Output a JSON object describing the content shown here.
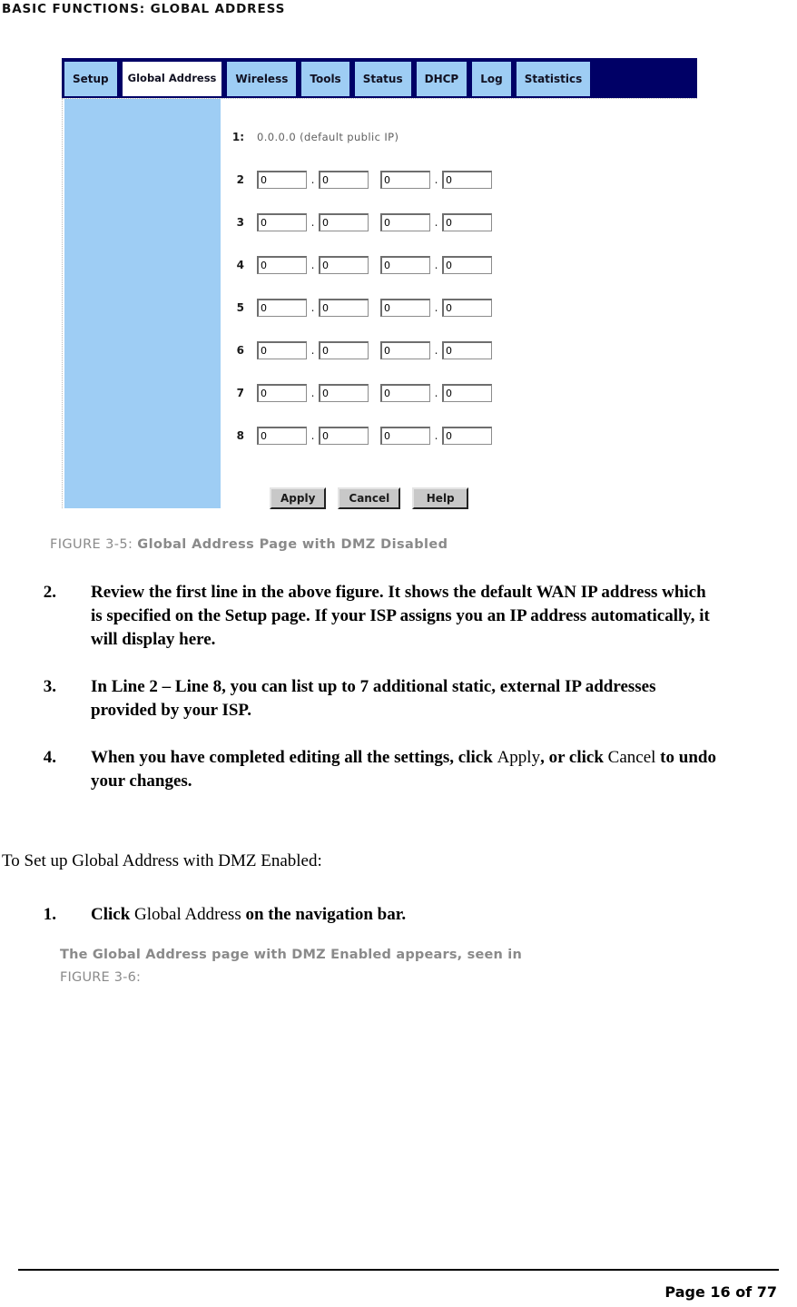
{
  "header": {
    "running_title": "BASIC FUNCTIONS: GLOBAL ADDRESS"
  },
  "figure": {
    "caption_label": "FIGURE 3-5:",
    "caption_title": "Global Address Page with DMZ Disabled",
    "nav_tabs": [
      {
        "label": "Setup",
        "active": false
      },
      {
        "label": "Global Address",
        "active": true
      },
      {
        "label": "Wireless",
        "active": false
      },
      {
        "label": "Tools",
        "active": false
      },
      {
        "label": "Status",
        "active": false
      },
      {
        "label": "DHCP",
        "active": false
      },
      {
        "label": "Log",
        "active": false
      },
      {
        "label": "Statistics",
        "active": false
      }
    ],
    "rows": [
      {
        "num": "1:",
        "type": "static",
        "text": "0.0.0.0 (default public IP)"
      },
      {
        "num": "2",
        "type": "inputs",
        "octets": [
          "0",
          "0",
          "0",
          "0"
        ]
      },
      {
        "num": "3",
        "type": "inputs",
        "octets": [
          "0",
          "0",
          "0",
          "0"
        ]
      },
      {
        "num": "4",
        "type": "inputs",
        "octets": [
          "0",
          "0",
          "0",
          "0"
        ]
      },
      {
        "num": "5",
        "type": "inputs",
        "octets": [
          "0",
          "0",
          "0",
          "0"
        ]
      },
      {
        "num": "6",
        "type": "inputs",
        "octets": [
          "0",
          "0",
          "0",
          "0"
        ]
      },
      {
        "num": "7",
        "type": "inputs",
        "octets": [
          "0",
          "0",
          "0",
          "0"
        ]
      },
      {
        "num": "8",
        "type": "inputs",
        "octets": [
          "0",
          "0",
          "0",
          "0"
        ]
      }
    ],
    "buttons": [
      {
        "label": "Apply"
      },
      {
        "label": "Cancel"
      },
      {
        "label": "Help"
      }
    ],
    "colors": {
      "navbar_background": "#000066",
      "tab_background": "#9ecdf4",
      "tab_active_background": "#ffffff",
      "sidebar_background": "#9ecdf4",
      "button_face": "#c8c8c8",
      "caption_text": "#8a8a8a"
    }
  },
  "steps": [
    {
      "num": "2.",
      "parts": [
        {
          "text": "Review the first line in the above figure. It shows the default WAN IP address which is specified on the Setup page. If your ISP assigns you an IP address automatically, it will display here.",
          "style": "bold"
        }
      ]
    },
    {
      "num": "3.",
      "parts": [
        {
          "text": "In Line 2 – Line 8, you can list up to 7 additional static, external IP addresses provided by your ISP.",
          "style": "bold"
        }
      ]
    },
    {
      "num": "4.",
      "parts": [
        {
          "text": "When you have completed editing all the settings, click ",
          "style": "bold"
        },
        {
          "text": "Apply",
          "style": "regular"
        },
        {
          "text": ", or click ",
          "style": "bold"
        },
        {
          "text": "Cancel",
          "style": "regular"
        },
        {
          "text": " to undo your changes.",
          "style": "bold"
        }
      ]
    }
  ],
  "lower": {
    "lead_paragraph": "To Set up Global Address with DMZ Enabled:",
    "steps": [
      {
        "num": "1.",
        "parts": [
          {
            "text": "Click ",
            "style": "bold"
          },
          {
            "text": "Global Address",
            "style": "regular"
          },
          {
            "text": " on the navigation bar.",
            "style": "bold"
          }
        ]
      }
    ],
    "note_line1": "The Global Address page with DMZ Enabled appears, seen in",
    "note_line2": "FIGURE 3-6:"
  },
  "footer": {
    "page_label": "Page 16 of 77"
  }
}
